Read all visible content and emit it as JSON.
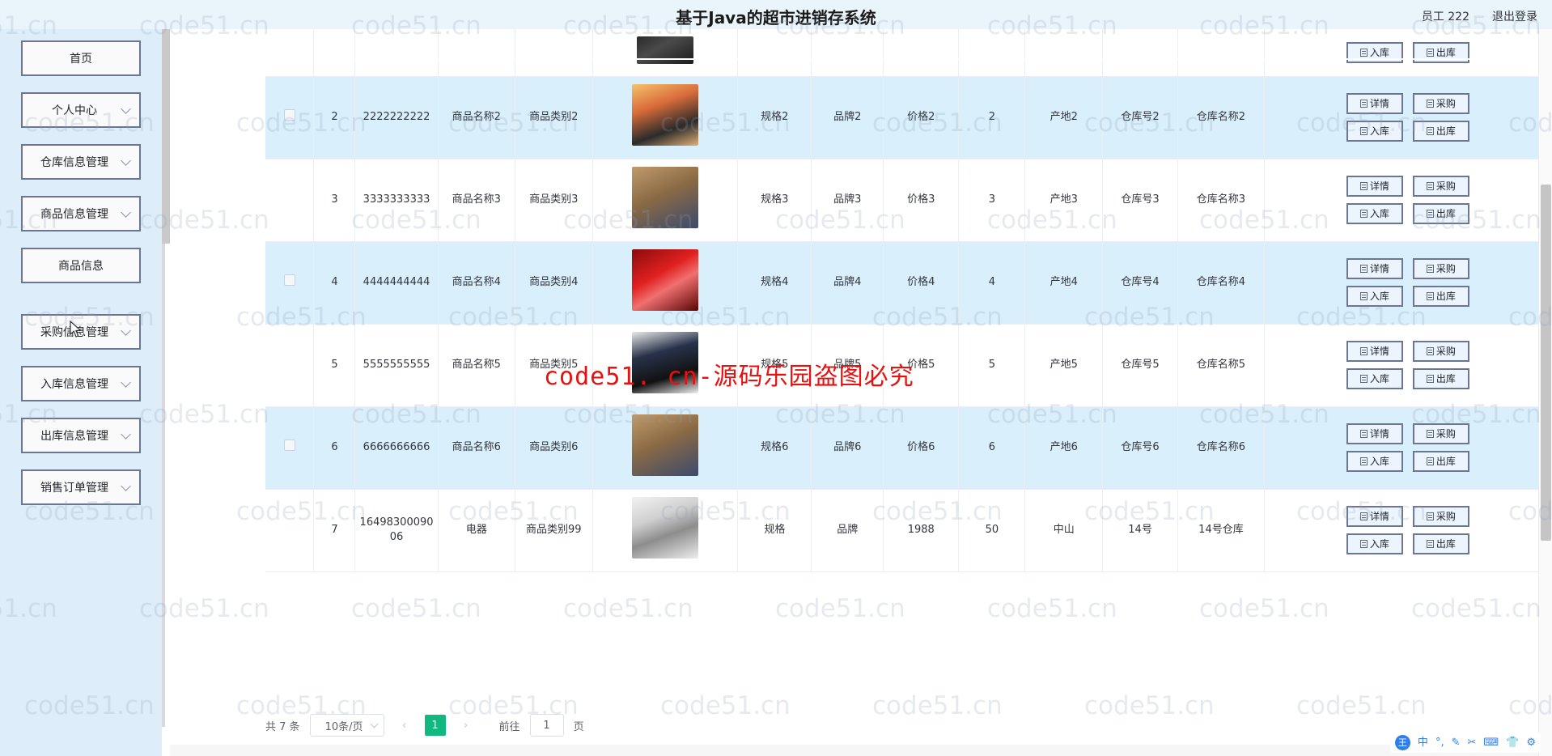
{
  "header": {
    "title": "基于Java的超市进销存系统",
    "user_label": "员工 222",
    "logout_label": "退出登录"
  },
  "sidebar": {
    "items": [
      {
        "label": "首页",
        "expandable": false,
        "sub": false
      },
      {
        "label": "个人中心",
        "expandable": true,
        "sub": false
      },
      {
        "label": "仓库信息管理",
        "expandable": true,
        "sub": false
      },
      {
        "label": "商品信息管理",
        "expandable": true,
        "sub": false
      },
      {
        "label": "商品信息",
        "expandable": false,
        "sub": true
      },
      {
        "label": "采购信息管理",
        "expandable": true,
        "sub": false
      },
      {
        "label": "入库信息管理",
        "expandable": true,
        "sub": false
      },
      {
        "label": "出库信息管理",
        "expandable": true,
        "sub": false
      },
      {
        "label": "销售订单管理",
        "expandable": true,
        "sub": false
      }
    ]
  },
  "buttons": {
    "detail": "详情",
    "purchase": "采购",
    "stock_in": "入库",
    "stock_out": "出库"
  },
  "table": {
    "rows": [
      {
        "index": "",
        "barcode": "",
        "name": "",
        "category": "",
        "spec": "",
        "brand": "",
        "price": "",
        "qty": "",
        "origin": "",
        "warehouse_no": "",
        "warehouse_name": "",
        "partial": true,
        "checked": false,
        "image": "electronics-dark"
      },
      {
        "index": "2",
        "barcode": "2222222222",
        "name": "商品名称2",
        "category": "商品类别2",
        "spec": "规格2",
        "brand": "品牌2",
        "price": "价格2",
        "qty": "2",
        "origin": "产地2",
        "warehouse_no": "仓库号2",
        "warehouse_name": "仓库名称2",
        "partial": false,
        "checked": false,
        "image": "bento-food"
      },
      {
        "index": "3",
        "barcode": "3333333333",
        "name": "商品名称3",
        "category": "商品类别3",
        "spec": "规格3",
        "brand": "品牌3",
        "price": "价格3",
        "qty": "3",
        "origin": "产地3",
        "warehouse_no": "仓库号3",
        "warehouse_name": "仓库名称3",
        "partial": false,
        "checked": false,
        "image": "leather-bag"
      },
      {
        "index": "4",
        "barcode": "4444444444",
        "name": "商品名称4",
        "category": "商品类别4",
        "spec": "规格4",
        "brand": "品牌4",
        "price": "价格4",
        "qty": "4",
        "origin": "产地4",
        "warehouse_no": "仓库号4",
        "warehouse_name": "仓库名称4",
        "partial": false,
        "checked": false,
        "image": "red-cosmetics"
      },
      {
        "index": "5",
        "barcode": "5555555555",
        "name": "商品名称5",
        "category": "商品类别5",
        "spec": "规格5",
        "brand": "品牌5",
        "price": "价格5",
        "qty": "5",
        "origin": "产地5",
        "warehouse_no": "仓库号5",
        "warehouse_name": "仓库名称5",
        "partial": false,
        "checked": false,
        "image": "mens-bottles"
      },
      {
        "index": "6",
        "barcode": "6666666666",
        "name": "商品名称6",
        "category": "商品类别6",
        "spec": "规格6",
        "brand": "品牌6",
        "price": "价格6",
        "qty": "6",
        "origin": "产地6",
        "warehouse_no": "仓库号6",
        "warehouse_name": "仓库名称6",
        "partial": false,
        "checked": false,
        "image": "leather-bag"
      },
      {
        "index": "7",
        "barcode": "1649830009006",
        "name": "电器",
        "category": "商品类别99",
        "spec": "规格",
        "brand": "品牌",
        "price": "1988",
        "qty": "50",
        "origin": "中山",
        "warehouse_no": "14号",
        "warehouse_name": "14号仓库",
        "partial": false,
        "checked": false,
        "image": "appliances"
      }
    ]
  },
  "pagination": {
    "total_label": "共 7 条",
    "page_size_label": "10条/页",
    "prev_icon": "‹",
    "next_icon": "›",
    "current_page": "1",
    "goto_label": "前往",
    "goto_value": "1",
    "page_unit": "页"
  },
  "watermark": {
    "tile_text": "code51.cn",
    "red_text": "code51. cn-源码乐园盗图必究"
  },
  "ime": {
    "logo": "王",
    "glyphs": [
      "中",
      "°,",
      "✎",
      "✂",
      "⌨",
      "👕",
      "⚙"
    ]
  },
  "colors": {
    "header_bg": "#eaf4fb",
    "sidebar_bg": "#ddeefa",
    "row_alt": "#d9effc",
    "page_active": "#11b87f",
    "btn_border": "#6b7693",
    "watermark_red": "#e8110f"
  }
}
